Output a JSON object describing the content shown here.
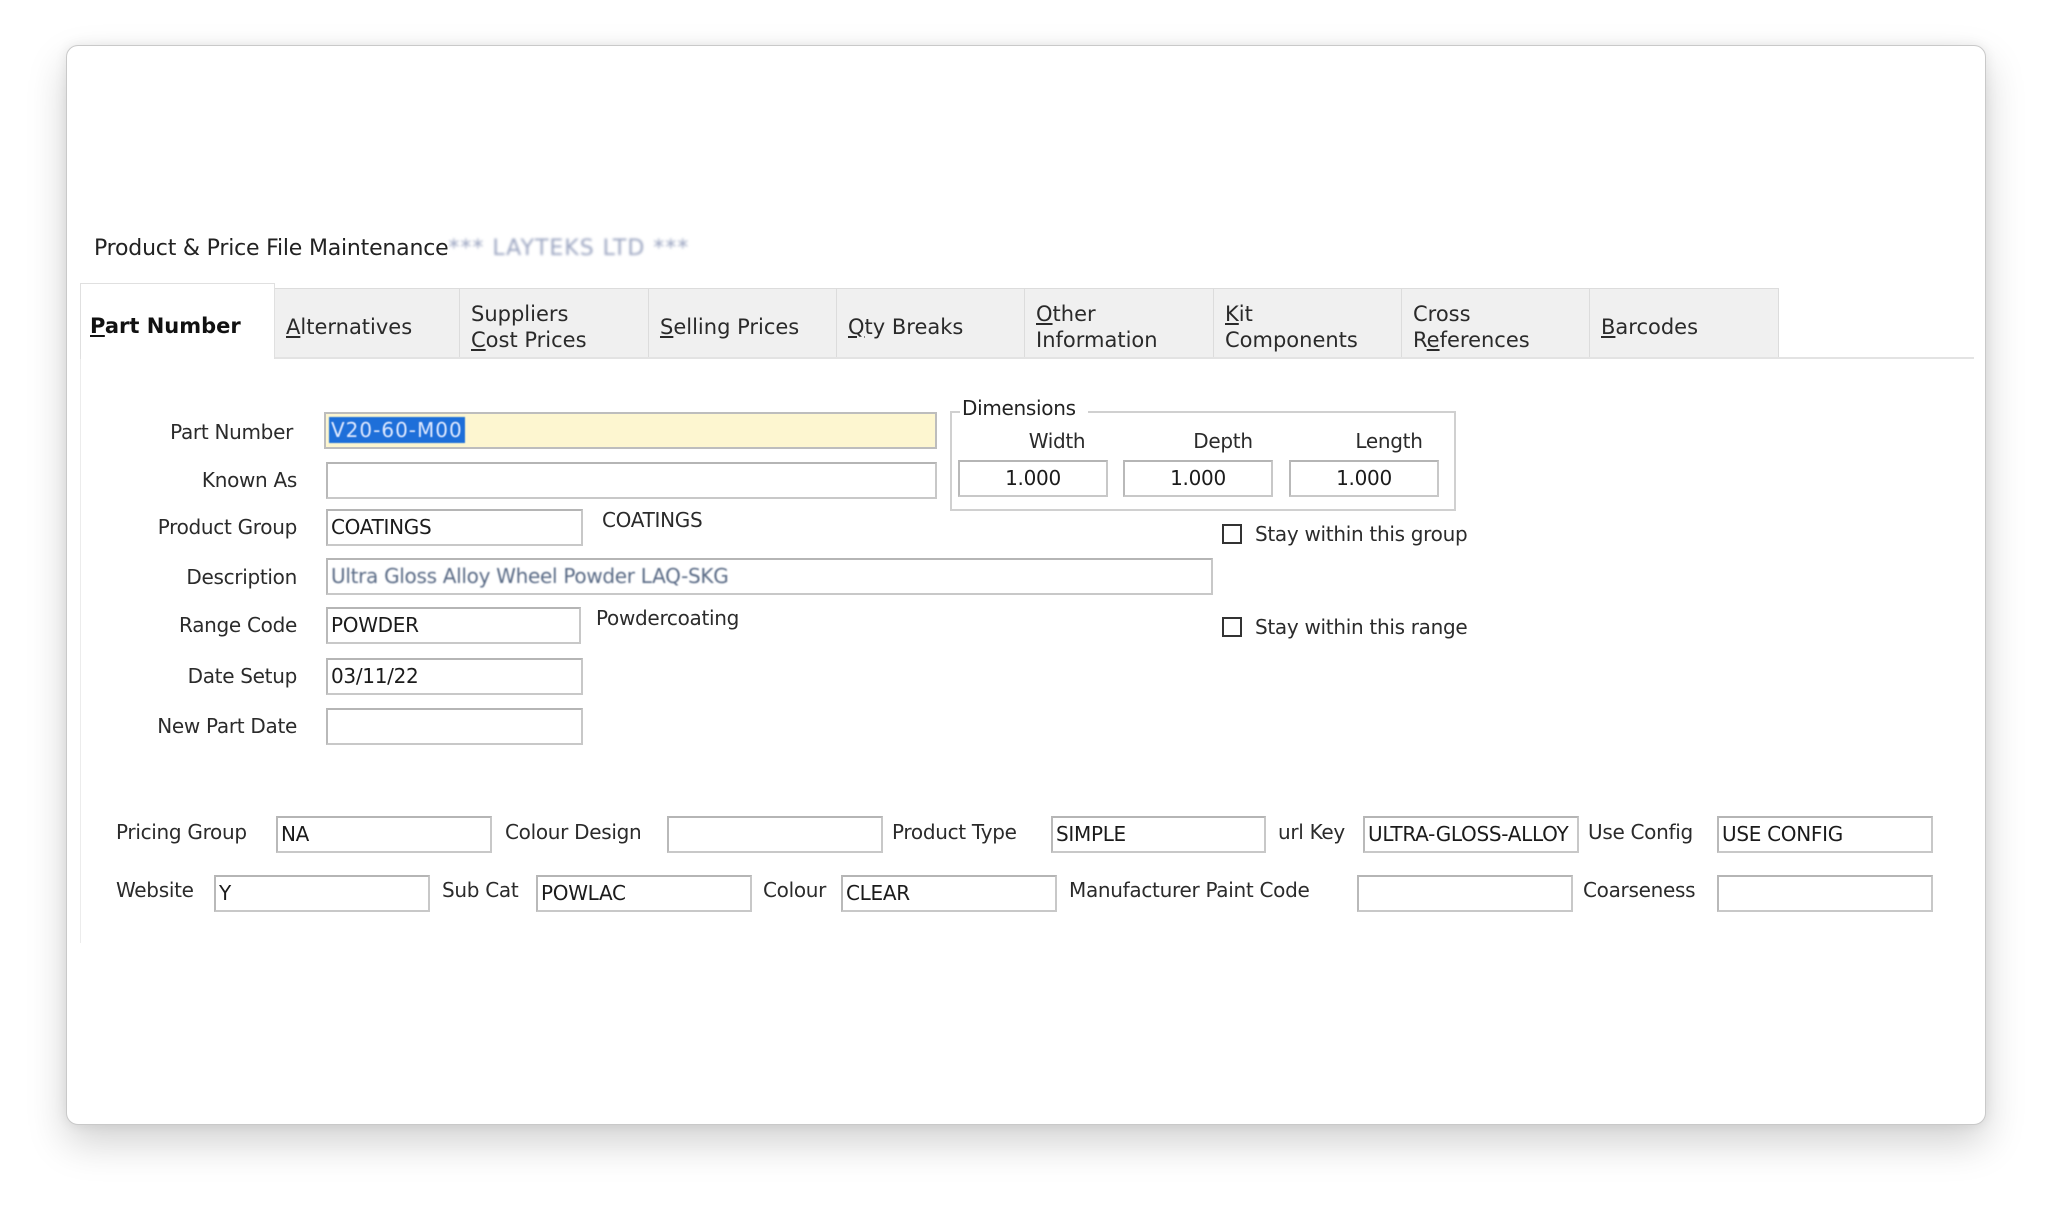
{
  "window": {
    "title": "Product & Price File Maintenance",
    "title_suffix_redacted": "*** LAYTEKS LTD ***"
  },
  "tabs": [
    {
      "label": "Part Number",
      "mnemonic": "P",
      "active": true
    },
    {
      "label": "Alternatives",
      "mnemonic": "A",
      "active": false
    },
    {
      "label_line1": "Suppliers",
      "label_line2": "Cost Prices",
      "mnemonic": "C",
      "active": false
    },
    {
      "label": "Selling Prices",
      "mnemonic": "S",
      "active": false
    },
    {
      "label": "Qty Breaks",
      "mnemonic": "Q",
      "active": false
    },
    {
      "label_line1": "Other",
      "label_line2": "Information",
      "mnemonic": "O",
      "active": false
    },
    {
      "label_line1": "Kit",
      "label_line2": "Components",
      "mnemonic": "K",
      "active": false
    },
    {
      "label_line1": "Cross",
      "label_line2": "References",
      "mnemonic": "e",
      "active": false
    },
    {
      "label": "Barcodes",
      "mnemonic": "B",
      "active": false
    }
  ],
  "form": {
    "part_number": {
      "label": "Part Number",
      "value": "V20-60-M00"
    },
    "known_as": {
      "label": "Known As",
      "value": ""
    },
    "product_group": {
      "label": "Product Group",
      "value": "COATINGS",
      "description": "COATINGS"
    },
    "description": {
      "label": "Description",
      "value": "Ultra Gloss Alloy Wheel Powder LAQ-SKG"
    },
    "range_code": {
      "label": "Range Code",
      "value": "POWDER",
      "description": "Powdercoating"
    },
    "date_setup": {
      "label": "Date Setup",
      "value": "03/11/22"
    },
    "new_part_date": {
      "label": "New Part Date",
      "value": ""
    }
  },
  "dimensions": {
    "legend": "Dimensions",
    "width": {
      "label": "Width",
      "value": "1.000"
    },
    "depth": {
      "label": "Depth",
      "value": "1.000"
    },
    "length": {
      "label": "Length",
      "value": "1.000"
    }
  },
  "checkboxes": {
    "stay_in_group": {
      "label": "Stay within this group",
      "checked": false
    },
    "stay_in_range": {
      "label": "Stay within this range",
      "checked": false
    }
  },
  "attributes": {
    "pricing_group": {
      "label": "Pricing Group",
      "value": "NA"
    },
    "colour_design": {
      "label": "Colour Design",
      "value": ""
    },
    "product_type": {
      "label": "Product Type",
      "value": "SIMPLE"
    },
    "url_key": {
      "label": "url Key",
      "value": "ULTRA-GLOSS-ALLOY"
    },
    "use_config": {
      "label": "Use Config",
      "value": "USE CONFIG"
    },
    "website": {
      "label": "Website",
      "value": "Y"
    },
    "sub_cat": {
      "label": "Sub Cat",
      "value": "POWLAC"
    },
    "colour": {
      "label": "Colour",
      "value": "CLEAR"
    },
    "manufacturer_paint_code": {
      "label": "Manufacturer Paint Code",
      "value": ""
    },
    "coarseness": {
      "label": "Coarseness",
      "value": ""
    }
  },
  "colors": {
    "focused_field_bg": "#fdf6d0",
    "selection_bg": "#1e6fd9",
    "tab_bg": "#f0f0f0"
  }
}
